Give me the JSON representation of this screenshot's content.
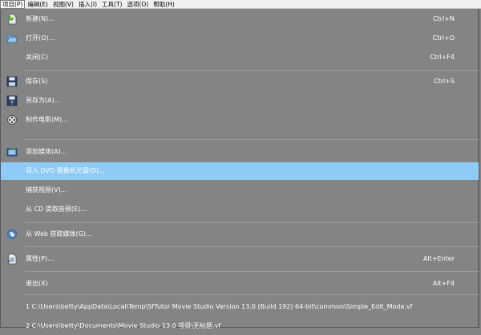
{
  "menubar": {
    "items": [
      "项目(P)",
      "编辑(E)",
      "视图(V)",
      "插入(I)",
      "工具(T)",
      "选项(O)",
      "帮助(H)"
    ]
  },
  "menu": {
    "new": {
      "label": "新建(N)...",
      "shortcut": "Ctrl+N",
      "icon": "new-project-icon"
    },
    "open": {
      "label": "打开(O)...",
      "shortcut": "Ctrl+O",
      "icon": "folder-open-icon"
    },
    "close": {
      "label": "关闭(C)",
      "shortcut": "Ctrl+F4"
    },
    "save": {
      "label": "保存(S)",
      "shortcut": "Ctrl+S",
      "icon": "floppy-disk-icon"
    },
    "save_as": {
      "label": "另存为(A)...",
      "icon": "save-as-icon"
    },
    "make_movie": {
      "label": "制作电影(M)...",
      "icon": "film-reel-icon"
    },
    "add_media": {
      "label": "添加媒体(A)...",
      "icon": "add-media-icon"
    },
    "import_dvd": {
      "label": "导入 DVD 摄像机光盘(D)..."
    },
    "capture_video": {
      "label": "捕获视频(V)..."
    },
    "extract_cd": {
      "label": "从 CD 提取音频(E)..."
    },
    "get_web_media": {
      "label": "从 Web 获取媒体(G)...",
      "icon": "globe-icon"
    },
    "properties": {
      "label": "属性(P)...",
      "shortcut": "Alt+Enter",
      "icon": "properties-icon"
    },
    "exit": {
      "label": "退出(X)",
      "shortcut": "Alt+F4"
    },
    "recent1": {
      "label": "1 C:\\Users\\betty\\AppData\\Local\\Temp\\SfTutor Movie Studio Version 13.0 (Build 192) 64-bit\\common\\Simple_Edit_Mode.vf"
    },
    "recent2": {
      "label": "2 C:\\Users\\betty\\Documents\\Movie Studio 13.0 项目\\无标题.vf"
    }
  }
}
